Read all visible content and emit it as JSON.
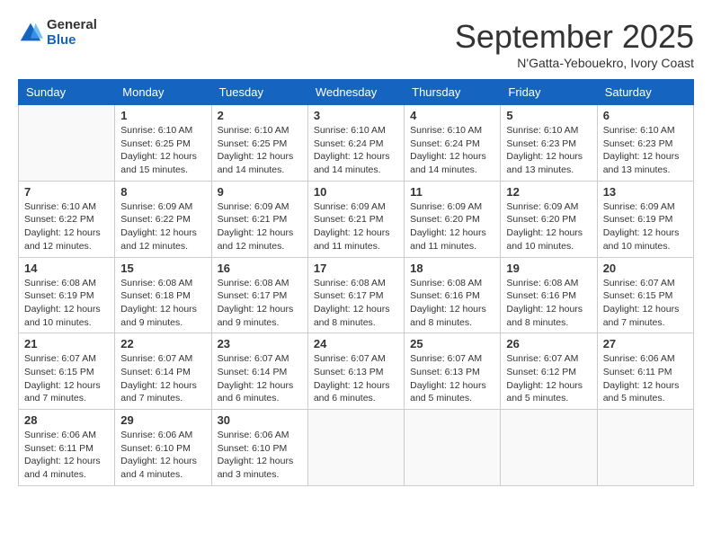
{
  "logo": {
    "general": "General",
    "blue": "Blue"
  },
  "title": "September 2025",
  "subtitle": "N'Gatta-Yebouekro, Ivory Coast",
  "days_of_week": [
    "Sunday",
    "Monday",
    "Tuesday",
    "Wednesday",
    "Thursday",
    "Friday",
    "Saturday"
  ],
  "weeks": [
    [
      {
        "day": "",
        "info": ""
      },
      {
        "day": "1",
        "info": "Sunrise: 6:10 AM\nSunset: 6:25 PM\nDaylight: 12 hours\nand 15 minutes."
      },
      {
        "day": "2",
        "info": "Sunrise: 6:10 AM\nSunset: 6:25 PM\nDaylight: 12 hours\nand 14 minutes."
      },
      {
        "day": "3",
        "info": "Sunrise: 6:10 AM\nSunset: 6:24 PM\nDaylight: 12 hours\nand 14 minutes."
      },
      {
        "day": "4",
        "info": "Sunrise: 6:10 AM\nSunset: 6:24 PM\nDaylight: 12 hours\nand 14 minutes."
      },
      {
        "day": "5",
        "info": "Sunrise: 6:10 AM\nSunset: 6:23 PM\nDaylight: 12 hours\nand 13 minutes."
      },
      {
        "day": "6",
        "info": "Sunrise: 6:10 AM\nSunset: 6:23 PM\nDaylight: 12 hours\nand 13 minutes."
      }
    ],
    [
      {
        "day": "7",
        "info": "Sunrise: 6:10 AM\nSunset: 6:22 PM\nDaylight: 12 hours\nand 12 minutes."
      },
      {
        "day": "8",
        "info": "Sunrise: 6:09 AM\nSunset: 6:22 PM\nDaylight: 12 hours\nand 12 minutes."
      },
      {
        "day": "9",
        "info": "Sunrise: 6:09 AM\nSunset: 6:21 PM\nDaylight: 12 hours\nand 12 minutes."
      },
      {
        "day": "10",
        "info": "Sunrise: 6:09 AM\nSunset: 6:21 PM\nDaylight: 12 hours\nand 11 minutes."
      },
      {
        "day": "11",
        "info": "Sunrise: 6:09 AM\nSunset: 6:20 PM\nDaylight: 12 hours\nand 11 minutes."
      },
      {
        "day": "12",
        "info": "Sunrise: 6:09 AM\nSunset: 6:20 PM\nDaylight: 12 hours\nand 10 minutes."
      },
      {
        "day": "13",
        "info": "Sunrise: 6:09 AM\nSunset: 6:19 PM\nDaylight: 12 hours\nand 10 minutes."
      }
    ],
    [
      {
        "day": "14",
        "info": "Sunrise: 6:08 AM\nSunset: 6:19 PM\nDaylight: 12 hours\nand 10 minutes."
      },
      {
        "day": "15",
        "info": "Sunrise: 6:08 AM\nSunset: 6:18 PM\nDaylight: 12 hours\nand 9 minutes."
      },
      {
        "day": "16",
        "info": "Sunrise: 6:08 AM\nSunset: 6:17 PM\nDaylight: 12 hours\nand 9 minutes."
      },
      {
        "day": "17",
        "info": "Sunrise: 6:08 AM\nSunset: 6:17 PM\nDaylight: 12 hours\nand 8 minutes."
      },
      {
        "day": "18",
        "info": "Sunrise: 6:08 AM\nSunset: 6:16 PM\nDaylight: 12 hours\nand 8 minutes."
      },
      {
        "day": "19",
        "info": "Sunrise: 6:08 AM\nSunset: 6:16 PM\nDaylight: 12 hours\nand 8 minutes."
      },
      {
        "day": "20",
        "info": "Sunrise: 6:07 AM\nSunset: 6:15 PM\nDaylight: 12 hours\nand 7 minutes."
      }
    ],
    [
      {
        "day": "21",
        "info": "Sunrise: 6:07 AM\nSunset: 6:15 PM\nDaylight: 12 hours\nand 7 minutes."
      },
      {
        "day": "22",
        "info": "Sunrise: 6:07 AM\nSunset: 6:14 PM\nDaylight: 12 hours\nand 7 minutes."
      },
      {
        "day": "23",
        "info": "Sunrise: 6:07 AM\nSunset: 6:14 PM\nDaylight: 12 hours\nand 6 minutes."
      },
      {
        "day": "24",
        "info": "Sunrise: 6:07 AM\nSunset: 6:13 PM\nDaylight: 12 hours\nand 6 minutes."
      },
      {
        "day": "25",
        "info": "Sunrise: 6:07 AM\nSunset: 6:13 PM\nDaylight: 12 hours\nand 5 minutes."
      },
      {
        "day": "26",
        "info": "Sunrise: 6:07 AM\nSunset: 6:12 PM\nDaylight: 12 hours\nand 5 minutes."
      },
      {
        "day": "27",
        "info": "Sunrise: 6:06 AM\nSunset: 6:11 PM\nDaylight: 12 hours\nand 5 minutes."
      }
    ],
    [
      {
        "day": "28",
        "info": "Sunrise: 6:06 AM\nSunset: 6:11 PM\nDaylight: 12 hours\nand 4 minutes."
      },
      {
        "day": "29",
        "info": "Sunrise: 6:06 AM\nSunset: 6:10 PM\nDaylight: 12 hours\nand 4 minutes."
      },
      {
        "day": "30",
        "info": "Sunrise: 6:06 AM\nSunset: 6:10 PM\nDaylight: 12 hours\nand 3 minutes."
      },
      {
        "day": "",
        "info": ""
      },
      {
        "day": "",
        "info": ""
      },
      {
        "day": "",
        "info": ""
      },
      {
        "day": "",
        "info": ""
      }
    ]
  ]
}
